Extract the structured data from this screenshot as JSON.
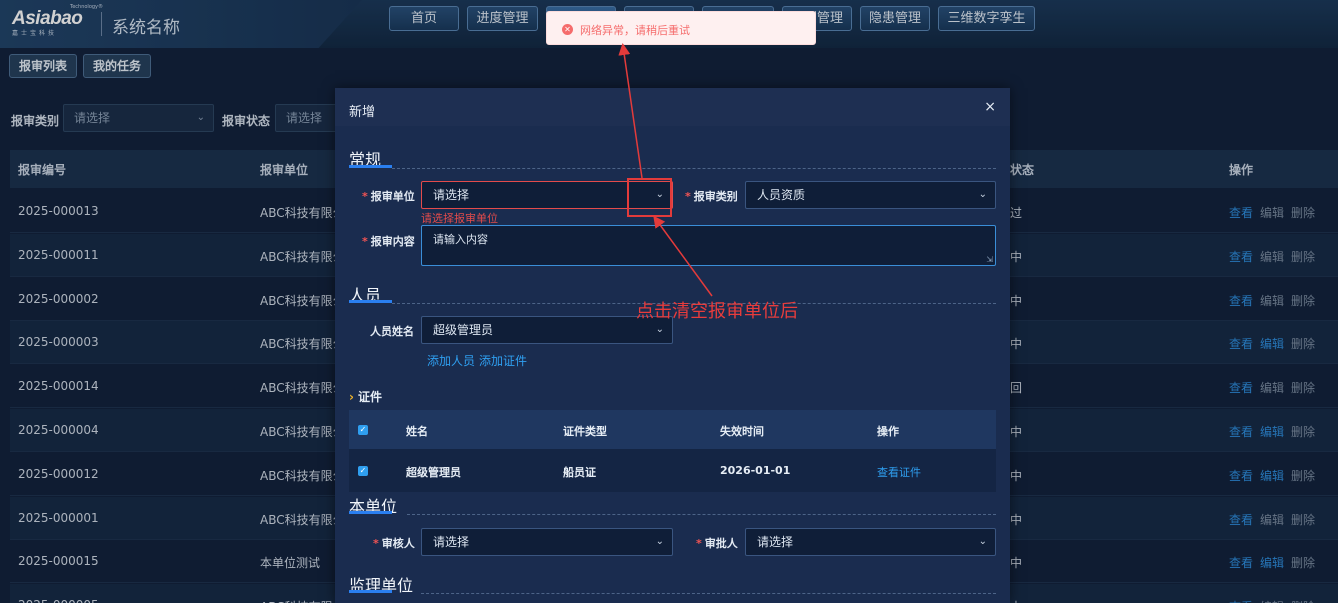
{
  "header": {
    "logo_text": "Asiabao",
    "logo_tm": "Technology®",
    "logo_sub": "嘉士宝科技",
    "system_name": "系统名称",
    "nav": [
      "首页",
      "进度管理",
      "",
      "",
      "",
      "训管理",
      "隐患管理",
      "三维数字孪生"
    ]
  },
  "subtabs": [
    "报审列表",
    "我的任务"
  ],
  "filters": {
    "type_label": "报审类别",
    "type_placeholder": "请选择",
    "status_label": "报审状态",
    "status_placeholder": "请选择"
  },
  "table": {
    "headers": [
      "报审编号",
      "报审单位",
      "状态",
      "操作"
    ],
    "rows": [
      {
        "id": "2025-000013",
        "unit": "ABC科技有限公",
        "status": "过"
      },
      {
        "id": "2025-000011",
        "unit": "ABC科技有限公",
        "status": "中"
      },
      {
        "id": "2025-000002",
        "unit": "ABC科技有限公",
        "status": "中"
      },
      {
        "id": "2025-000003",
        "unit": "ABC科技有限公",
        "status": "中"
      },
      {
        "id": "2025-000014",
        "unit": "ABC科技有限公",
        "status": "回"
      },
      {
        "id": "2025-000004",
        "unit": "ABC科技有限公",
        "status": "中"
      },
      {
        "id": "2025-000012",
        "unit": "ABC科技有限公",
        "status": "中"
      },
      {
        "id": "2025-000001",
        "unit": "ABC科技有限公",
        "status": "中"
      },
      {
        "id": "2025-000015",
        "unit": "本单位测试",
        "status": "中"
      },
      {
        "id": "2025-000005",
        "unit": "ABC科技有限公",
        "status": "中"
      }
    ],
    "actions": {
      "view": "查看",
      "edit": "编辑",
      "delete": "删除"
    }
  },
  "modal": {
    "title": "新增",
    "close": "×",
    "section_general": "常规",
    "unit_label": "报审单位",
    "unit_value": "请选择",
    "unit_error": "请选择报审单位",
    "category_label": "报审类别",
    "category_value": "人员资质",
    "content_label": "报审内容",
    "content_placeholder": "请输入内容",
    "section_person": "人员",
    "person_label": "人员姓名",
    "person_value": "超级管理员",
    "add_person": "添加人员",
    "add_cert": "添加证件",
    "cert_label": "证件",
    "cert_headers": [
      "姓名",
      "证件类型",
      "失效时间",
      "操作"
    ],
    "cert_row": {
      "name": "超级管理员",
      "type": "船员证",
      "expire": "2026-01-01",
      "action": "查看证件"
    },
    "section_unit": "本单位",
    "reviewer_label": "审核人",
    "reviewer_value": "请选择",
    "approver_label": "审批人",
    "approver_value": "请选择",
    "section_supervision": "监理单位"
  },
  "toast": {
    "message": "网络异常，请稍后重试",
    "icon": "error-icon"
  },
  "annotation": {
    "text": "点击清空报审单位后",
    "color": "#e33b3b"
  }
}
